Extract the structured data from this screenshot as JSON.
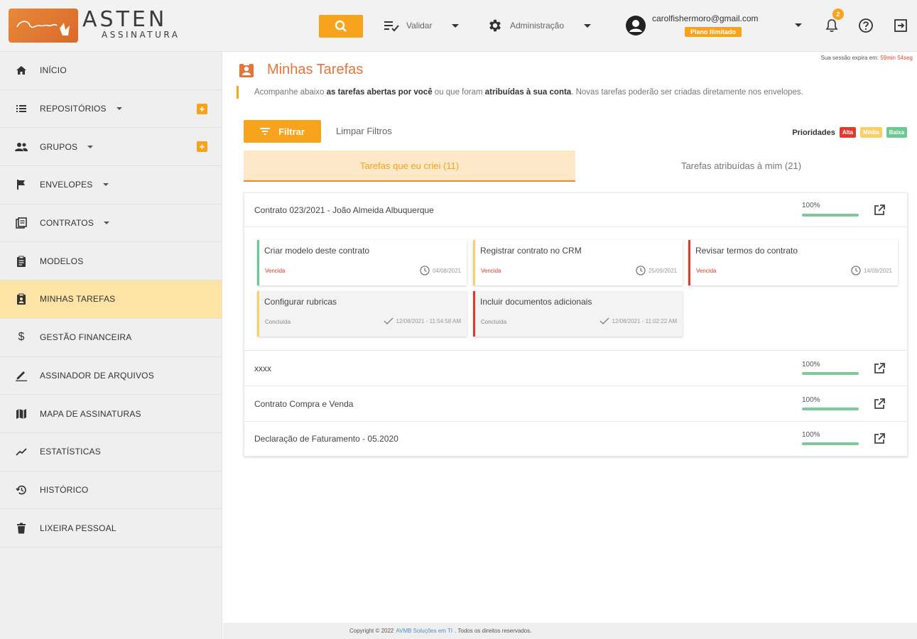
{
  "header": {
    "brand": "ASTEN",
    "brand_sub": "ASSINATURA",
    "logo_mark": "Criar",
    "menu_validar": "Validar",
    "menu_admin": "Administração",
    "user_email": "carolfishermoro@gmail.com",
    "plan": "Plano Ilimitado",
    "notifications": "2",
    "colors": {
      "accent": "#f7a31c",
      "title": "#e8743a"
    }
  },
  "sidebar": {
    "items": [
      {
        "label": "INÍCIO",
        "icon": "home-icon"
      },
      {
        "label": "REPOSITÓRIOS",
        "icon": "list-icon"
      },
      {
        "label": "GRUPOS",
        "icon": "people-icon"
      },
      {
        "label": "ENVELOPES",
        "icon": "flag-icon"
      },
      {
        "label": "CONTRATOS",
        "icon": "contract-icon"
      },
      {
        "label": "MODELOS",
        "icon": "clipboard-icon"
      },
      {
        "label": "MINHAS TAREFAS",
        "icon": "task-icon"
      },
      {
        "label": "GESTÃO FINANCEIRA",
        "icon": "dollar-icon"
      },
      {
        "label": "ASSINADOR DE ARQUIVOS",
        "icon": "pen-icon"
      },
      {
        "label": "MAPA DE ASSINATURAS",
        "icon": "map-icon"
      },
      {
        "label": "ESTATÍSTICAS",
        "icon": "chart-icon"
      },
      {
        "label": "HISTÓRICO",
        "icon": "history-icon"
      },
      {
        "label": "LIXEIRA PESSOAL",
        "icon": "trash-icon"
      }
    ]
  },
  "main": {
    "session_text": "Sua sessão expira em:",
    "session_time": "59min 54seg",
    "title": "Minhas Tarefas",
    "subtitle_1": "Acompanhe abaixo ",
    "subtitle_b1": "as tarefas abertas por você",
    "subtitle_2": " ou que foram ",
    "subtitle_b2": "atribuídas à sua conta",
    "subtitle_3": ". Novas tarefas poderão ser criadas diretamente nos envelopes.",
    "filter_label": "Filtrar",
    "clear_filters": "Limpar Filtros",
    "priorities_label": "Prioridades",
    "priority_high": "Alta",
    "priority_medium": "Média",
    "priority_low": "Baixa",
    "tab_created": "Tarefas que eu criei (11)",
    "tab_assigned": "Tarefas atribuídas à mim (21)",
    "envelopes": [
      {
        "name": "Contrato 023/2021 - João Almeida Albuquerque",
        "progress_label": "100%"
      },
      {
        "name": "xxxx",
        "progress_label": "100%"
      },
      {
        "name": "Contrato Compra e Venda",
        "progress_label": "100%"
      },
      {
        "name": "Declaração de Faturamento - 05.2020",
        "progress_label": "100%"
      }
    ],
    "tasks": [
      {
        "title": "Criar modelo deste contrato",
        "status": "Vencida",
        "date": "04/08/2021"
      },
      {
        "title": "Registrar contrato no CRM",
        "status": "Vencida",
        "date": "25/09/2021"
      },
      {
        "title": "Revisar termos do contrato",
        "status": "Vencida",
        "date": "14/09/2021"
      },
      {
        "title": "Configurar rubricas",
        "status": "Concluída",
        "date": "12/08/2021 - 11:54:58 AM"
      },
      {
        "title": "Incluir documentos adicionais",
        "status": "Concluída",
        "date": "12/08/2021 - 11:02:22 AM"
      }
    ]
  },
  "footer": {
    "pre": "Copyright © 2022",
    "company": "AVMB Soluções em TI",
    "post": ". Todos os direitos reservados."
  }
}
